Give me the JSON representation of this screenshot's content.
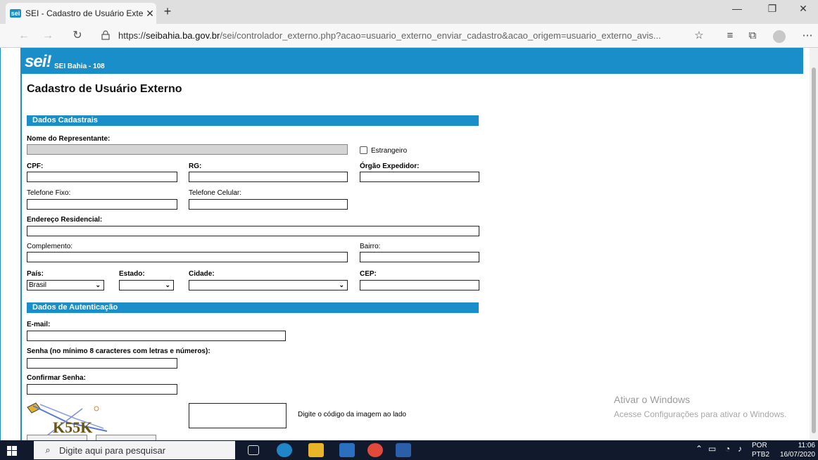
{
  "browser": {
    "tab_title": "SEI - Cadastro de Usuário Externo",
    "favicon_text": "sei",
    "new_tab": "+",
    "tab_close": "✕",
    "url_prefix": "https://",
    "url_host": "seibahia.ba.gov.br",
    "url_rest": "/sei/controlador_externo.php?acao=usuario_externo_enviar_cadastro&acao_origem=usuario_externo_avis...",
    "window_controls": [
      "—",
      "❐",
      "✕"
    ]
  },
  "header": {
    "logo": "sei!",
    "subtitle": "SEI Bahia - 108"
  },
  "page_title": "Cadastro de Usuário Externo",
  "sections": {
    "dados_cadastrais": "Dados Cadastrais",
    "dados_autenticacao": "Dados de Autenticação"
  },
  "fields": {
    "nome_representante": "Nome do Representante:",
    "estrangeiro": "Estrangeiro",
    "cpf": "CPF:",
    "rg": "RG:",
    "orgao_expedidor": "Órgão Expedidor:",
    "telefone_fixo": "Telefone Fixo:",
    "telefone_celular": "Telefone Celular:",
    "endereco": "Endereço Residencial:",
    "complemento": "Complemento:",
    "bairro": "Bairro:",
    "pais": "País:",
    "estado": "Estado:",
    "cidade": "Cidade:",
    "cep": "CEP:",
    "email": "E-mail:",
    "senha": "Senha (no mínimo 8 caracteres com letras e números):",
    "confirmar_senha": "Confirmar Senha:",
    "captcha_hint": "Digite o código da imagem ao lado",
    "captcha_code": "K55K"
  },
  "selects": {
    "pais_value": "Brasil",
    "estado_value": "",
    "cidade_value": ""
  },
  "watermark": {
    "line1": "Ativar o Windows",
    "line2": "Acesse Configurações para ativar o Windows."
  },
  "taskbar": {
    "search_placeholder": "Digite aqui para pesquisar",
    "lang": "POR",
    "layout": "PTB2",
    "time": "11:06",
    "date": "16/07/2020"
  },
  "colors": {
    "accent": "#1a8ec9",
    "taskbar": "#101a2c"
  }
}
